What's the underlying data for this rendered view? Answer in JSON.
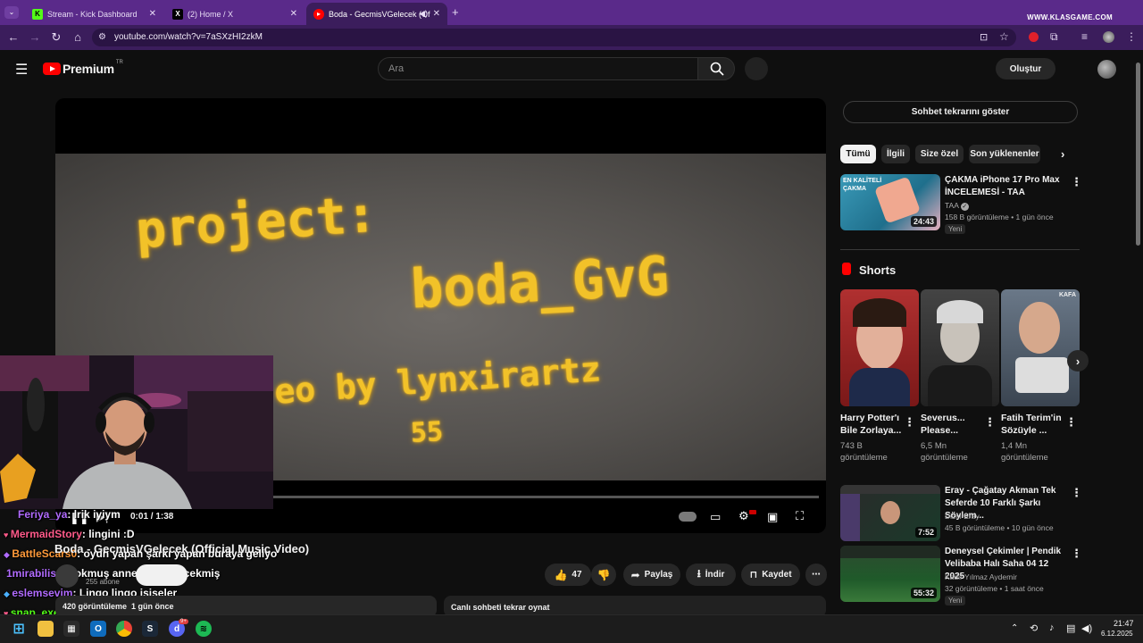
{
  "browser": {
    "tabs": [
      {
        "title": "Stream - Kick Dashboard"
      },
      {
        "title": "(2) Home / X"
      },
      {
        "title": "Boda - GecmisVGelecek (Of"
      }
    ],
    "url": "youtube.com/watch?v=7aSXzHI2zkM",
    "watermark": "WWW.KLASGAME.COM"
  },
  "youtube": {
    "logo_text": "Premium",
    "logo_country": "TR",
    "search_placeholder": "Ara",
    "create_label": "Oluştur"
  },
  "video": {
    "overlay_line1": "project:",
    "overlay_line2": "boda_GvG",
    "overlay_line3": "eo by lynxirartz",
    "overlay_line4": "55",
    "time": "0:01 / 1:38",
    "title": "Boda - GecmisVGelecek (Official Music Video)",
    "subscribers": "255 abone",
    "views": "420 görüntüleme",
    "age": "1 gün önce",
    "likes": "47",
    "share": "Paylaş",
    "download": "İndir",
    "save": "Kaydet",
    "replay_chat": "Canlı sohbeti tekrar oynat"
  },
  "chat": [
    {
      "user": "Feriya_ya",
      "msg": ": lrik iyiym",
      "color": "#b16bff"
    },
    {
      "user": "MermaidStory",
      "msg": ": lingini :D",
      "color": "#ff5a8a"
    },
    {
      "user": "BattleScars0",
      "msg": ": oyun yapan şarkı yapan buraya geliyo",
      "color": "#ff9a3a"
    },
    {
      "user": "1mirabilis1",
      "msg": ": yokmuş annesine gidecekmiş",
      "color": "#b16bff"
    },
    {
      "user": "eslemsevim",
      "msg": ": Lingo lingo işişeler",
      "color": "#b16bff"
    },
    {
      "user": "snap_exe",
      "msg": ":",
      "color": "#53fc18"
    }
  ],
  "sidebar": {
    "chat_replay": "Sohbet tekrarını göster",
    "chips": [
      "Tümü",
      "İlgili",
      "Size özel",
      "Son yüklenenler"
    ],
    "rec1": {
      "title": "ÇAKMA iPhone 17 Pro Max İNCELEMESİ - TAA",
      "channel": "TAA",
      "meta": "158 B görüntüleme • 1 gün önce",
      "badge": "Yeni",
      "duration": "24:43",
      "thumb_text": "EN KALİTELİ ÇAKMA"
    },
    "shorts_heading": "Shorts",
    "shorts": [
      {
        "title": "Harry Potter'ı Bile Zorlaya...",
        "views": "743 B görüntüleme"
      },
      {
        "title": "Severus... Please...",
        "views": "6,5 Mn görüntüleme"
      },
      {
        "title": "Fatih Terim'in Sözüyle ...",
        "views": "1,4 Mn görüntüleme"
      }
    ],
    "short3_tag": "KAFA",
    "rec2": {
      "title": "Eray - Çağatay Akman Tek Seferde 10 Farklı Şarkı Söylem...",
      "channel": "Dizcı Eray",
      "meta": "45 B görüntüleme • 10 gün önce",
      "duration": "7:52"
    },
    "rec3": {
      "title": "Deneysel Çekimler | Pendik Velibaba Halı Saha 04 12 2025",
      "channel": "Kadir Yılmaz Aydemir",
      "meta": "32 görüntüleme • 1 saat önce",
      "badge": "Yeni",
      "duration": "55:32"
    }
  },
  "taskbar": {
    "time": "21:47",
    "date": "6.12.2025",
    "discord_badge": "9+"
  }
}
